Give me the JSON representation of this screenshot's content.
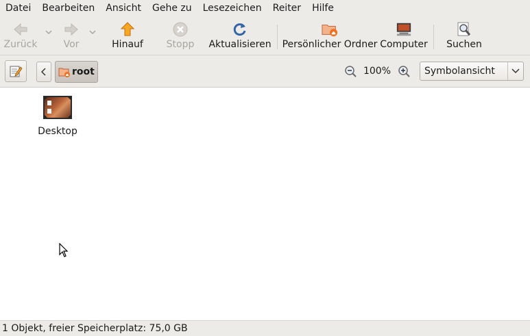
{
  "menubar": {
    "items": [
      "Datei",
      "Bearbeiten",
      "Ansicht",
      "Gehe zu",
      "Lesezeichen",
      "Reiter",
      "Hilfe"
    ]
  },
  "toolbar": {
    "back_label": "Zurück",
    "forward_label": "Vor",
    "up_label": "Hinauf",
    "stop_label": "Stopp",
    "reload_label": "Aktualisieren",
    "home_label": "Persönlicher Ordner",
    "computer_label": "Computer",
    "search_label": "Suchen"
  },
  "location": {
    "crumb_label": "root",
    "zoom_level": "100%",
    "view_mode": "Symbolansicht"
  },
  "files": [
    {
      "name": "Desktop",
      "icon": "desktop-folder-icon"
    }
  ],
  "status": {
    "text": "1 Objekt, freier Speicherplatz: 75,0 GB"
  },
  "colors": {
    "chrome_bg": "#edebe8",
    "content_bg": "#ffffff",
    "accent_orange": "#f08a24",
    "reload_blue": "#3465a4"
  }
}
